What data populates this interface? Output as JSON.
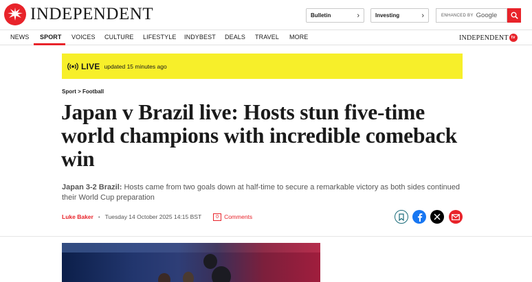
{
  "header": {
    "logo_text": "INDEPENDENT",
    "bulletin_label": "Bulletin",
    "investing_label": "Investing",
    "search_enhanced": "ENHANCED BY",
    "search_google": "Google"
  },
  "nav": {
    "items": [
      "NEWS",
      "SPORT",
      "VOICES",
      "CULTURE",
      "LIFESTYLE",
      "INDYBEST",
      "DEALS",
      "TRAVEL",
      "MORE"
    ],
    "active": "SPORT",
    "tv_brand": "INDEPENDENT",
    "tv_badge": "tv"
  },
  "live": {
    "label": "LIVE",
    "updated": "updated 15 minutes ago",
    "accent": "#f7ef2a"
  },
  "article": {
    "breadcrumb": "Sport > Football",
    "headline": "Japan v Brazil live: Hosts stun five-time world champions with incredible comeback win",
    "standfirst_lead": "Japan 3-2 Brazil:",
    "standfirst_body": " Hosts came from two goals down at half-time to secure a remarkable victory as both sides continued their World Cup preparation",
    "author": "Luke Baker",
    "date": "Tuesday 14 October 2025 14:15 BST",
    "comment_count": "0",
    "comments_label": "Comments"
  },
  "share": {
    "icons": [
      "bookmark-icon",
      "facebook-icon",
      "x-icon",
      "email-icon"
    ]
  },
  "colors": {
    "brand_red": "#e8232a",
    "facebook": "#1877f2"
  }
}
